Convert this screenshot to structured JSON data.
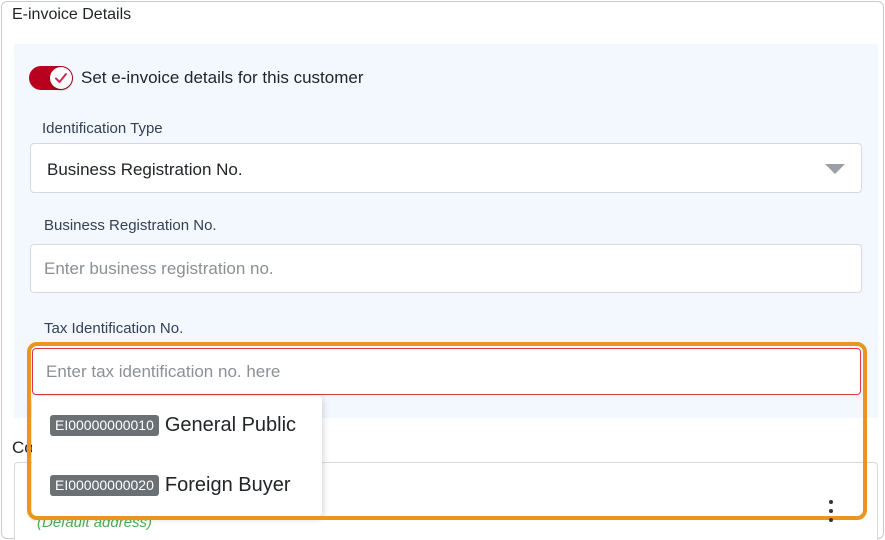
{
  "section": {
    "title": "E-invoice Details"
  },
  "toggle": {
    "label": "Set e-invoice details for this customer",
    "on": true,
    "color": "#b8001f",
    "icon": "check-icon"
  },
  "identification_type": {
    "label": "Identification Type",
    "value": "Business Registration No.",
    "icon": "caret-down-icon"
  },
  "business_registration": {
    "label": "Business Registration No.",
    "placeholder": "Enter business registration no.",
    "value": ""
  },
  "tax_identification": {
    "label": "Tax Identification No.",
    "placeholder": "Enter tax identification no. here",
    "value": ""
  },
  "suggestions": [
    {
      "code": "EI00000000010",
      "name": "General Public"
    },
    {
      "code": "EI00000000020",
      "name": "Foreign Buyer"
    }
  ],
  "address": {
    "label_fragment": "Co",
    "default_text": "(Default address)",
    "menu_icon": "more-vertical-icon"
  },
  "colors": {
    "highlight": "#e8961e",
    "error_border": "#dc3545",
    "panel_bg": "#f2f8fd",
    "default_green": "#4caf50"
  }
}
